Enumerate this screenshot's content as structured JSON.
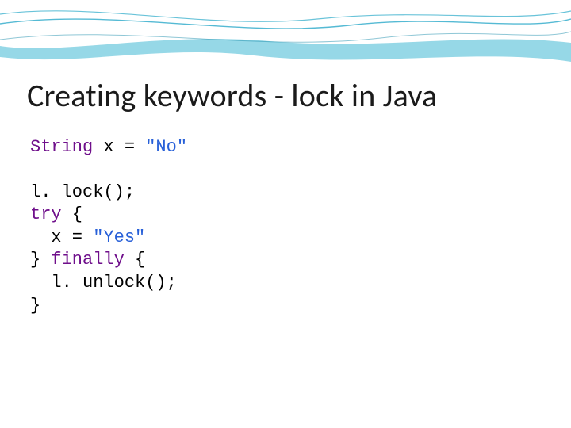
{
  "slide": {
    "title": "Creating keywords - lock in Java"
  },
  "code": {
    "l1_kw_type": "String",
    "l1_rest": " x = ",
    "l1_str": "\"No\"",
    "l2": "l. lock();",
    "l3_kw": "try",
    "l3_rest": " {",
    "l4_a": "  x = ",
    "l4_str": "\"Yes\"",
    "l5_a": "} ",
    "l5_kw": "finally",
    "l5_b": " {",
    "l6": "  l. unlock();",
    "l7": "}"
  }
}
